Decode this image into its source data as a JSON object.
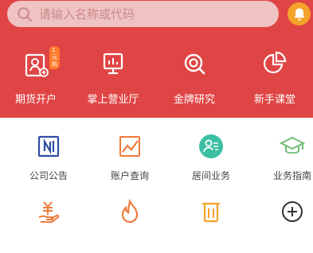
{
  "search": {
    "placeholder": "请输入名称或代码"
  },
  "quick_actions": [
    {
      "label": "期货开户",
      "icon": "account-open-icon",
      "badge": "1元购"
    },
    {
      "label": "掌上营业厅",
      "icon": "monitor-icon"
    },
    {
      "label": "金牌研究",
      "icon": "research-icon"
    },
    {
      "label": "新手课堂",
      "icon": "pie-chart-icon"
    }
  ],
  "services": [
    {
      "label": "公司公告",
      "icon": "notice-icon"
    },
    {
      "label": "账户查询",
      "icon": "trend-chart-icon"
    },
    {
      "label": "居间业务",
      "icon": "broker-icon"
    },
    {
      "label": "业务指南",
      "icon": "graduation-cap-icon"
    },
    {
      "label": "",
      "icon": "yuan-hand-icon"
    },
    {
      "label": "",
      "icon": "flame-icon"
    },
    {
      "label": "",
      "icon": "shop-icon"
    },
    {
      "label": "",
      "icon": "add-icon"
    }
  ],
  "colors": {
    "header_bg": "#e04545",
    "search_bg": "#f0c3c3",
    "bell_bg": "#f3a22a",
    "teal": "#3dbfa3",
    "navy": "#2f4ea1",
    "orange": "#f07a3a"
  }
}
